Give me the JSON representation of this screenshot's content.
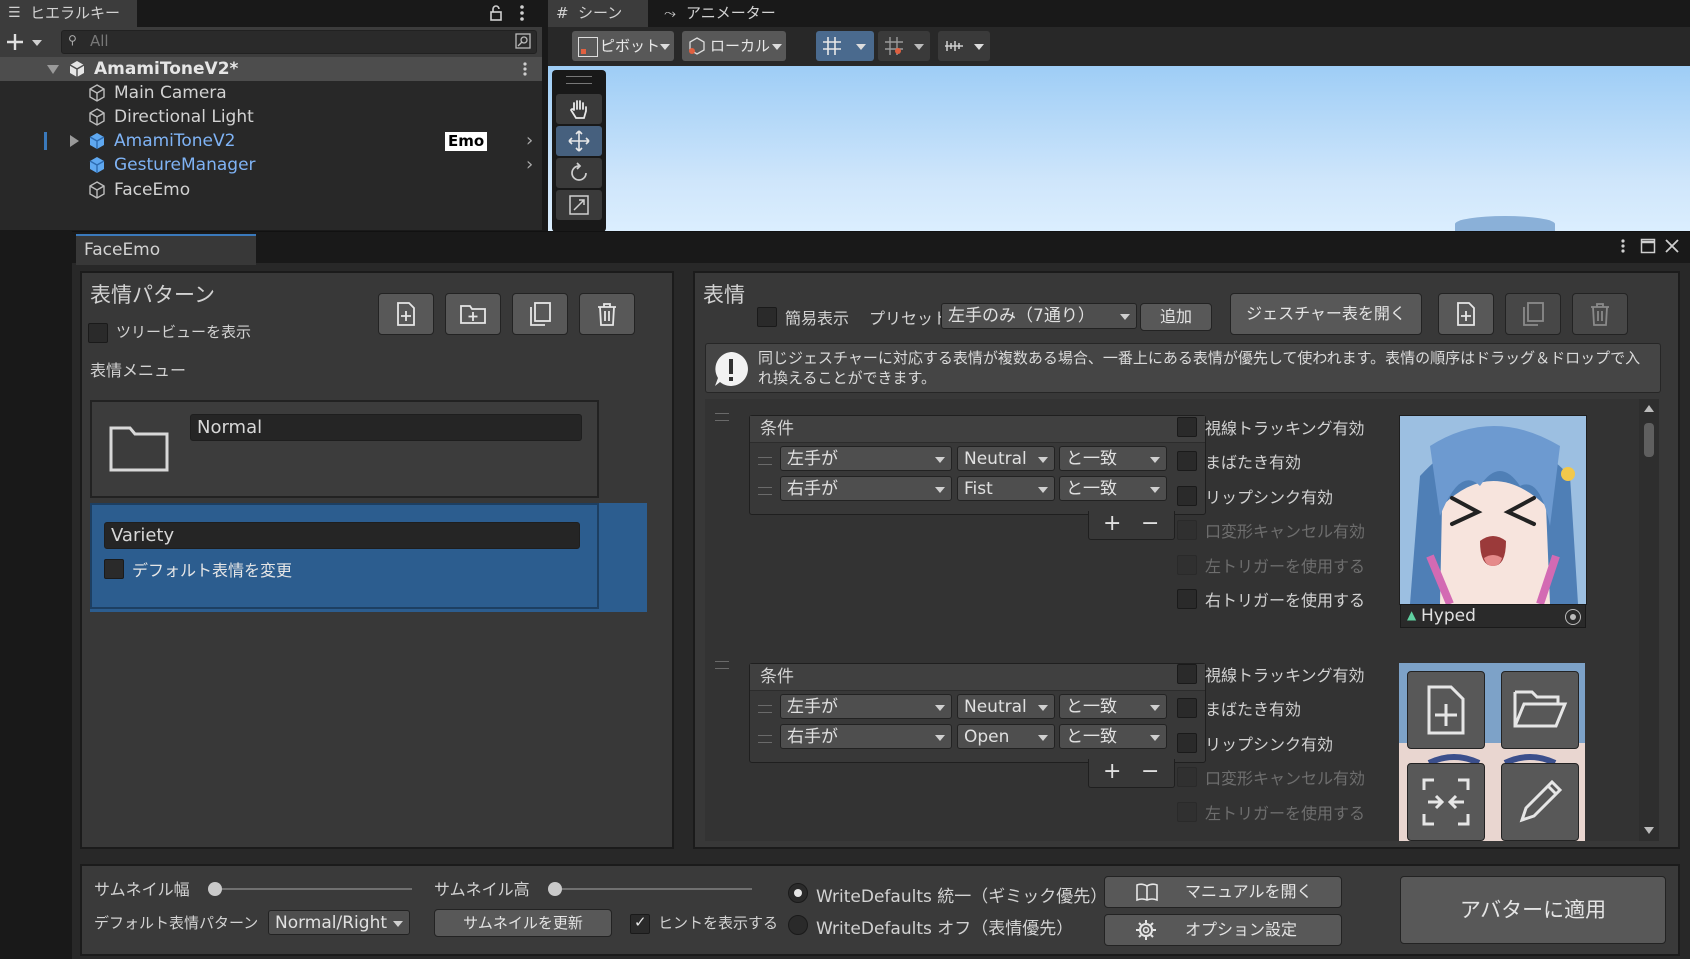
{
  "hierarchy": {
    "tab_label": "ヒエラルキー",
    "search_placeholder": "All",
    "rows": [
      {
        "label": "AmamiToneV2*"
      },
      {
        "label": "Main Camera"
      },
      {
        "label": "Directional Light"
      },
      {
        "label": "AmamiToneV2",
        "badge": "Emo"
      },
      {
        "label": "GestureManager"
      },
      {
        "label": "FaceEmo"
      }
    ]
  },
  "scene": {
    "tabs": [
      "シーン",
      "アニメーター"
    ],
    "pivot_label": "ピボット",
    "local_label": "ローカル"
  },
  "faceemo": {
    "window_title": "FaceEmo",
    "left": {
      "title": "表情パターン",
      "treeview_label": "ツリービューを表示",
      "menu_label": "表情メニュー",
      "folder_name": "Normal",
      "selected_name": "Variety",
      "default_change_label": "デフォルト表情を変更"
    },
    "right": {
      "title": "表情",
      "simple_label": "簡易表示",
      "preset_label": "プリセット",
      "preset_value": "左手のみ（7通り）",
      "add_label": "追加",
      "gesture_table_label": "ジェスチャー表を開く",
      "info_text": "同じジェスチャーに対応する表情が複数ある場合、一番上にある表情が優先して使われます。表情の順序はドラッグ＆ドロップで入れ換えることができます。",
      "entries": [
        {
          "cond_header": "条件",
          "conditions": [
            {
              "hand": "左手が",
              "gesture": "Neutral",
              "match": "と一致"
            },
            {
              "hand": "右手が",
              "gesture": "Fist",
              "match": "と一致"
            }
          ],
          "options": [
            "視線トラッキング有効",
            "まばたき有効",
            "リップシンク有効",
            "口変形キャンセル有効",
            "左トリガーを使用する",
            "右トリガーを使用する"
          ],
          "clip_name": "Hyped"
        },
        {
          "cond_header": "条件",
          "conditions": [
            {
              "hand": "左手が",
              "gesture": "Neutral",
              "match": "と一致"
            },
            {
              "hand": "右手が",
              "gesture": "Open",
              "match": "と一致"
            }
          ],
          "options": [
            "視線トラッキング有効",
            "まばたき有効",
            "リップシンク有効",
            "口変形キャンセル有効",
            "左トリガーを使用する"
          ]
        }
      ],
      "plus": "+",
      "minus": "−"
    },
    "bottom": {
      "thumb_width_label": "サムネイル幅",
      "thumb_height_label": "サムネイル高",
      "default_pattern_label": "デフォルト表情パターン",
      "default_pattern_value": "Normal/Right",
      "update_thumb_label": "サムネイルを更新",
      "hint_label": "ヒントを表示する",
      "wd_on_label": "WriteDefaults 統一（ギミック優先）",
      "wd_off_label": "WriteDefaults オフ（表情優先）",
      "manual_label": "マニュアルを開く",
      "option_label": "オプション設定",
      "apply_label": "アバターに適用"
    }
  },
  "colors": {
    "selection_blue": "#2c5d8f",
    "prefab_blue": "#7fb3f5",
    "accent": "#3a79bb"
  }
}
